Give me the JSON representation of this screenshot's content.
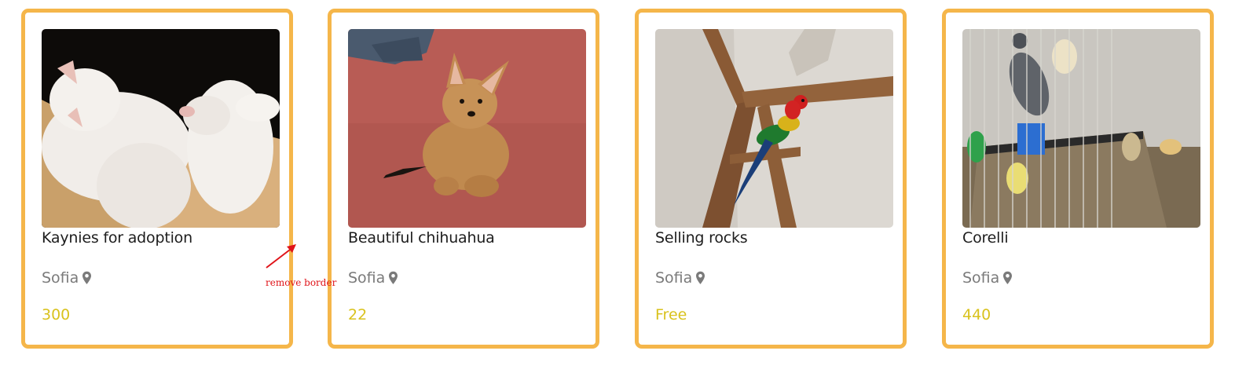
{
  "listings": [
    {
      "title": "Kaynies for adoption",
      "location": "Sofia",
      "price": "300",
      "image": "two-white-cats-sleeping-photo"
    },
    {
      "title": "Beautiful chihuahua",
      "location": "Sofia",
      "price": "22",
      "image": "chihuahua-puppy-on-red-carpet-photo"
    },
    {
      "title": "Selling rocks",
      "location": "Sofia",
      "price": "Free",
      "image": "rosella-parrot-in-wooden-cage-photo"
    },
    {
      "title": "Corelli",
      "location": "Sofia",
      "price": "440",
      "image": "cockatiels-in-wire-cage-photo"
    }
  ],
  "annotation": {
    "text": "remove border",
    "color": "#e0141a"
  },
  "colors": {
    "card_border": "#f5b64a",
    "title": "#1d1d1d",
    "location": "#7a7a7a",
    "price": "#d9c21d"
  },
  "icons": {
    "location": "map-pin-icon"
  }
}
